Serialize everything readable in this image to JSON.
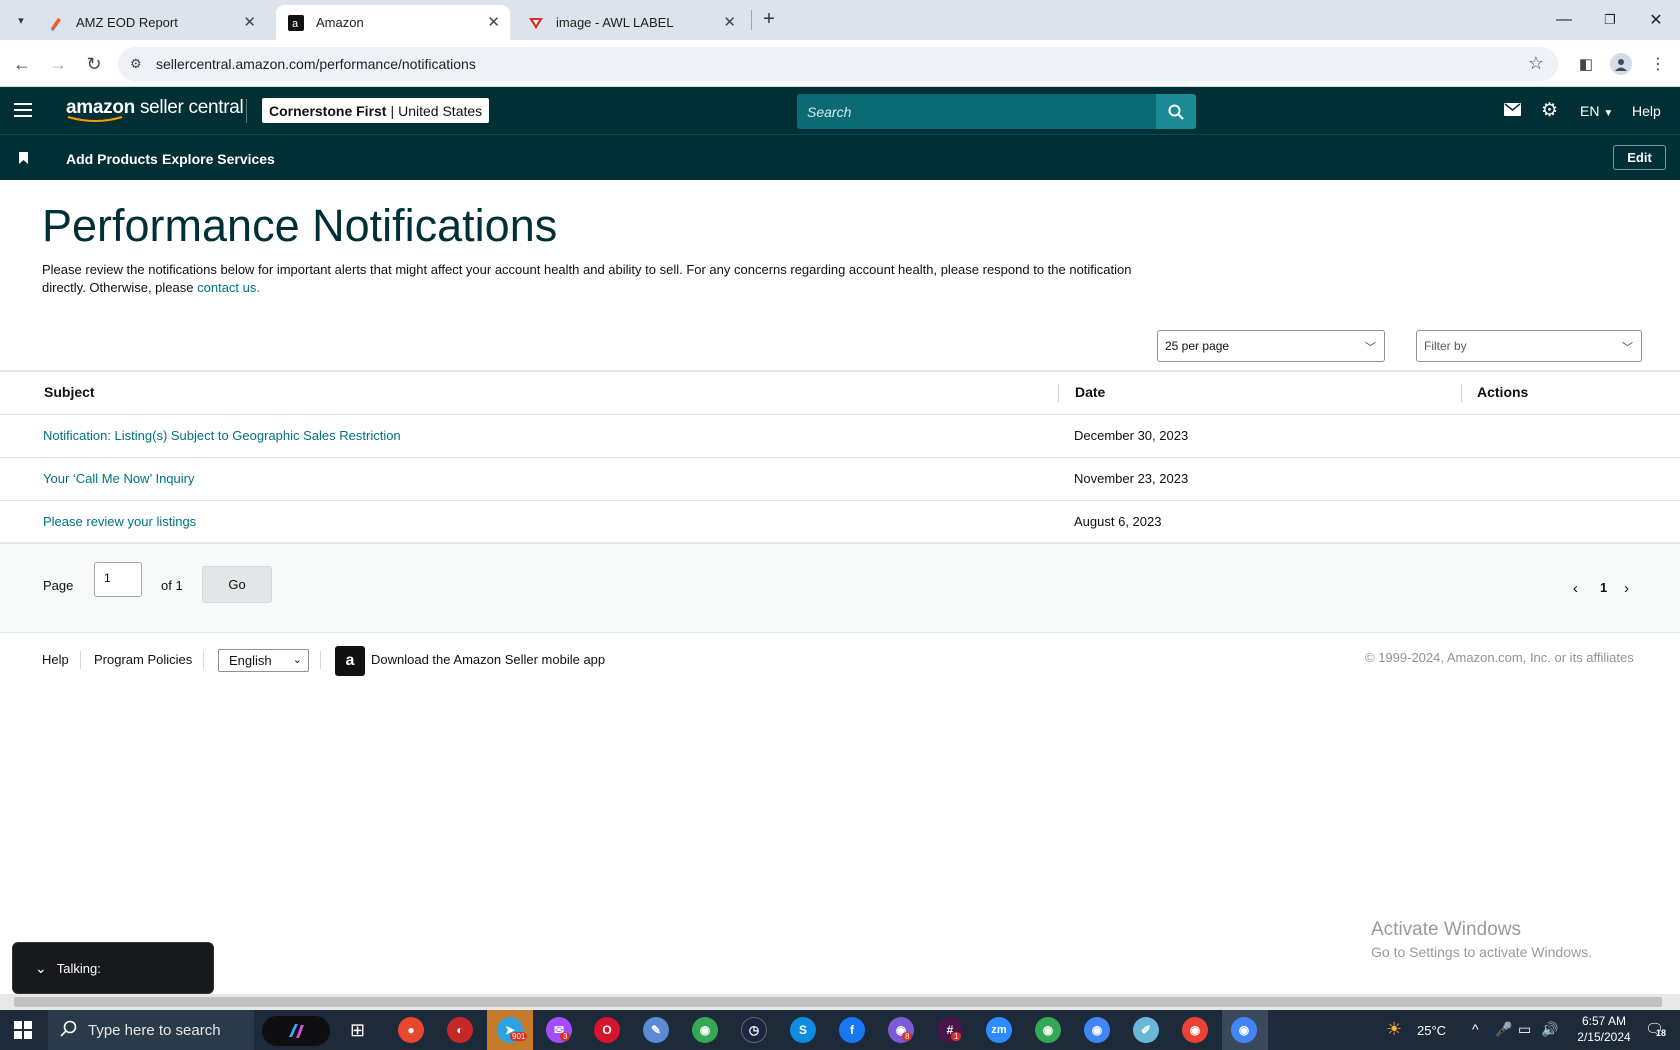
{
  "browser": {
    "tabs": [
      {
        "title": "AMZ EOD Report"
      },
      {
        "title": "Amazon"
      },
      {
        "title": "image - AWL LABEL"
      }
    ],
    "url": "sellercentral.amazon.com/performance/notifications"
  },
  "header": {
    "logo_brand": "amazon",
    "logo_product": "seller central",
    "account_name": "Cornerstone First",
    "account_sep": "|",
    "account_region": "United States",
    "search_placeholder": "Search",
    "language": "EN",
    "help_label": "Help"
  },
  "subnav": {
    "items": [
      "Add Products",
      "Explore Services"
    ],
    "edit_label": "Edit"
  },
  "page": {
    "title": "Performance Notifications",
    "description": "Please review the notifications below for important alerts that might affect your account health and ability to sell. For any concerns regarding account health, please respond to the notification directly. Otherwise, please",
    "contact_link": "contact us.",
    "per_page": "25 per page",
    "filter_placeholder": "Filter by"
  },
  "table": {
    "columns": [
      "Subject",
      "Date",
      "Actions"
    ],
    "rows": [
      {
        "subject": "Notification: Listing(s) Subject to Geographic Sales Restriction",
        "date": "December 30, 2023"
      },
      {
        "subject": "Your ‘Call Me Now’ Inquiry",
        "date": "November 23, 2023"
      },
      {
        "subject": "Please review your listings",
        "date": "August 6, 2023"
      }
    ]
  },
  "pagination": {
    "page_label": "Page",
    "current_page": "1",
    "of_label": "of 1",
    "go_label": "Go",
    "page_number": "1"
  },
  "footer": {
    "help": "Help",
    "program_policies": "Program Policies",
    "language": "English",
    "app_text": "Download the Amazon Seller mobile app",
    "copyright": "© 1999-2024, Amazon.com, Inc. or its affiliates"
  },
  "overlay": {
    "talking": "Talking:",
    "activate_title": "Activate Windows",
    "activate_sub": "Go to Settings to activate Windows."
  },
  "taskbar": {
    "search_placeholder": "Type here to search",
    "weather": "25°C",
    "time": "6:57 AM",
    "date": "2/15/2024",
    "notifications": "18",
    "badges": {
      "telegram": "901",
      "messenger": "3",
      "chrome_profile": "8",
      "slack": "1"
    }
  },
  "colors": {
    "header_bg": "#002f36",
    "link": "#007185",
    "search_bg": "#0a6b75"
  }
}
